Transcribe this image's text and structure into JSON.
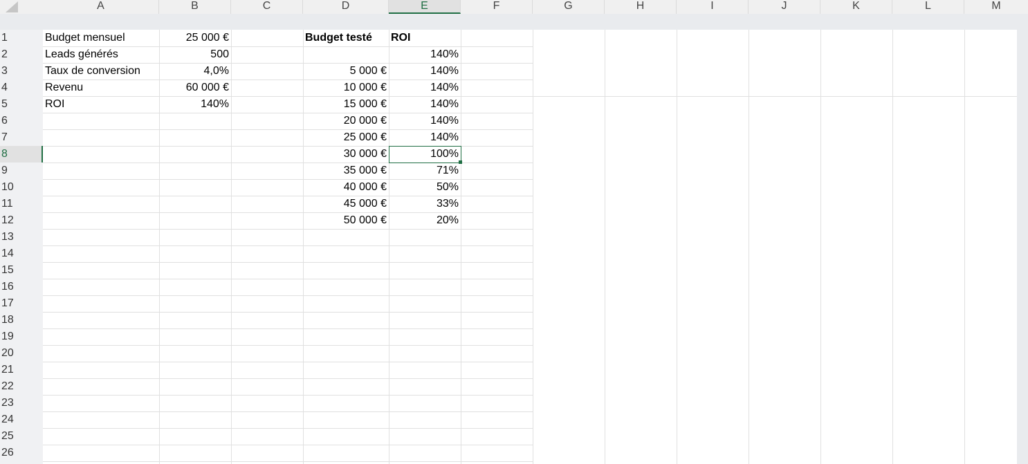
{
  "columns": [
    "A",
    "B",
    "C",
    "D",
    "E",
    "F",
    "G",
    "H",
    "I",
    "J",
    "K",
    "L",
    "M"
  ],
  "selected_column": "E",
  "rows": [
    "1",
    "2",
    "3",
    "4",
    "5",
    "6",
    "7",
    "8",
    "9",
    "10",
    "11",
    "12",
    "13",
    "14",
    "15",
    "16",
    "17",
    "18",
    "19",
    "20",
    "21",
    "22",
    "23",
    "24",
    "25",
    "26"
  ],
  "selected_row": "8",
  "cells": {
    "A1": "Budget mensuel",
    "B1": "25 000 €",
    "A2": "Leads générés",
    "B2": "500",
    "A3": "Taux de conversion",
    "B3": "4,0%",
    "A4": "Revenu",
    "B4": "60 000 €",
    "A5": "ROI",
    "B5": "140%",
    "D1": "Budget testé",
    "E1": "ROI",
    "E2": "140%",
    "D3": "5 000 €",
    "E3": "140%",
    "D4": "10 000 €",
    "E4": "140%",
    "D5": "15 000 €",
    "E5": "140%",
    "D6": "20 000 €",
    "E6": "140%",
    "D7": "25 000 €",
    "E7": "140%",
    "D8": "30 000 €",
    "E8": "100%",
    "D9": "35 000 €",
    "E9": "71%",
    "D10": "40 000 €",
    "E10": "50%",
    "D11": "45 000 €",
    "E11": "33%",
    "D12": "50 000 €",
    "E12": "20%"
  },
  "active_cell": "E8"
}
